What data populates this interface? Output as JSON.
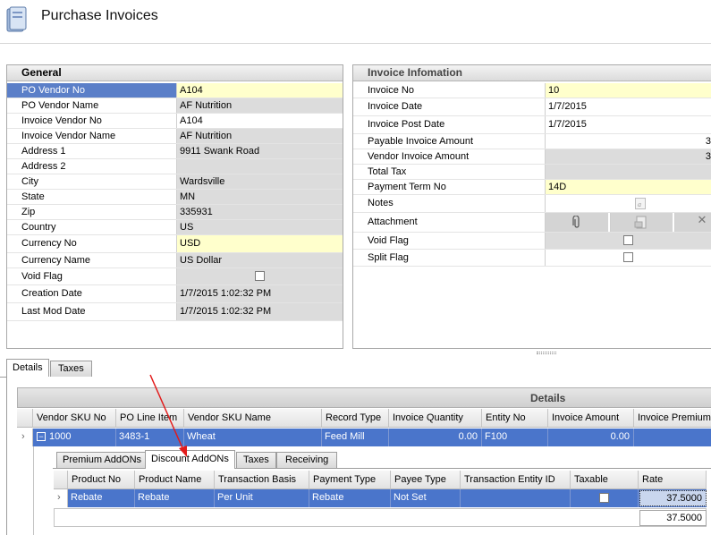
{
  "header": {
    "title": "Purchase Invoices"
  },
  "general": {
    "title": "General",
    "rows": [
      {
        "label": "PO Vendor No",
        "value": "A104"
      },
      {
        "label": "PO Vendor Name",
        "value": "AF Nutrition"
      },
      {
        "label": "Invoice Vendor No",
        "value": "A104"
      },
      {
        "label": "Invoice Vendor Name",
        "value": "AF Nutrition"
      },
      {
        "label": "Address 1",
        "value": "9911 Swank Road"
      },
      {
        "label": "Address 2",
        "value": ""
      },
      {
        "label": "City",
        "value": "Wardsville"
      },
      {
        "label": "State",
        "value": "MN"
      },
      {
        "label": "Zip",
        "value": "335931"
      },
      {
        "label": "Country",
        "value": "US"
      },
      {
        "label": "Currency No",
        "value": "USD"
      },
      {
        "label": "Currency Name",
        "value": "US Dollar"
      },
      {
        "label": "Void Flag",
        "value": ""
      },
      {
        "label": "Creation Date",
        "value": "1/7/2015 1:02:32 PM"
      },
      {
        "label": "Last Mod Date",
        "value": "1/7/2015 1:02:32 PM"
      }
    ]
  },
  "invoice": {
    "title": "Invoice Infomation",
    "rows": [
      {
        "label": "Invoice No",
        "value": "10"
      },
      {
        "label": "Invoice Date",
        "value": "1/7/2015"
      },
      {
        "label": "Invoice Post Date",
        "value": "1/7/2015"
      },
      {
        "label": "Payable Invoice Amount",
        "value": "3"
      },
      {
        "label": "Vendor Invoice Amount",
        "value": "3"
      },
      {
        "label": "Total Tax",
        "value": ""
      },
      {
        "label": "Payment Term No",
        "value": "14D"
      },
      {
        "label": "Notes",
        "value": ""
      },
      {
        "label": "Attachment",
        "value": ""
      },
      {
        "label": "Void Flag",
        "value": ""
      },
      {
        "label": "Split Flag",
        "value": ""
      }
    ]
  },
  "tabs": {
    "details": "Details",
    "taxes": "Taxes"
  },
  "details_grid": {
    "title": "Details",
    "columns": [
      "Vendor SKU No",
      "PO Line Item",
      "Vendor SKU Name",
      "Record Type",
      "Invoice Quantity",
      "Entity No",
      "Invoice Amount",
      "Invoice Premiums"
    ],
    "row": {
      "expander": "−",
      "sku": "1000",
      "line": "3483-1",
      "name": "Wheat",
      "record_type": "Feed Mill",
      "qty": "0.00",
      "entity": "F100",
      "amount": "0.00",
      "premiums": ""
    }
  },
  "subtabs": [
    "Premium AddONs",
    "Discount AddONs",
    "Taxes",
    "Receiving"
  ],
  "discount_grid": {
    "columns": [
      "Product No",
      "Product Name",
      "Transaction Basis",
      "Payment Type",
      "Payee Type",
      "Transaction Entity ID",
      "Taxable",
      "Rate"
    ],
    "row": {
      "product_no": "Rebate",
      "product_name": "Rebate",
      "basis": "Per Unit",
      "payment_type": "Rebate",
      "payee_type": "Not Set",
      "entity_id": "",
      "rate": "37.5000"
    },
    "total": "37.5000"
  },
  "colors": {
    "selection": "#4a75cb",
    "required": "#ffffcc",
    "annotation_arrow": "#e21b1b"
  }
}
